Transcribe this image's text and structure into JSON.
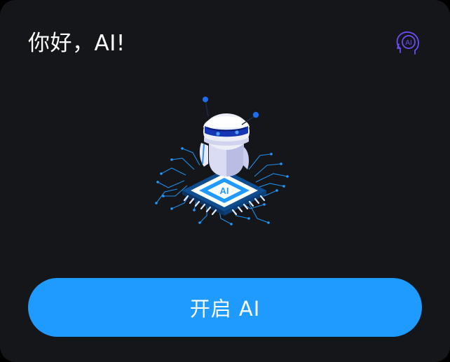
{
  "header": {
    "title": "你好，AI!",
    "ai_icon_text": "AI"
  },
  "illustration": {
    "chip_label": "AI"
  },
  "actions": {
    "start_label": "开启 AI"
  },
  "colors": {
    "card_background": "#15161a",
    "button": "#1f9bff",
    "icon_accent": "#6b4cf5",
    "circuit": "#1f9bff"
  }
}
